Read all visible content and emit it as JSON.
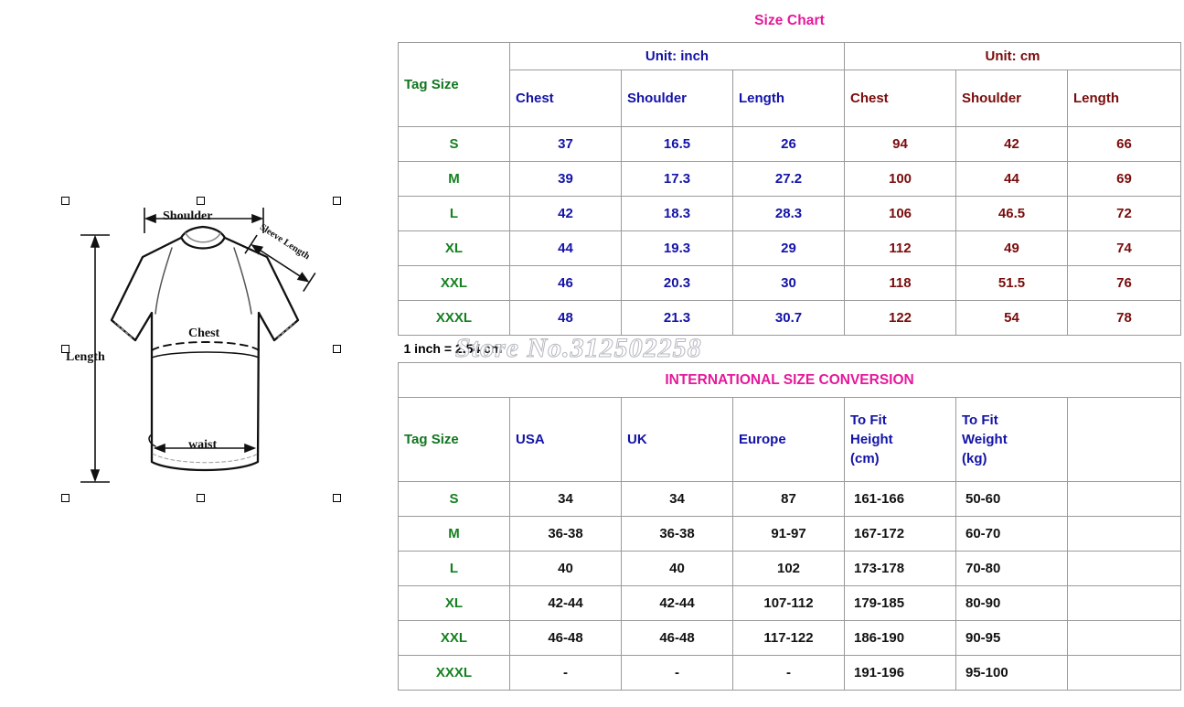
{
  "diagram": {
    "labels": {
      "shoulder": "Shoulder",
      "sleeve_length": "Sleeve Length",
      "chest": "Chest",
      "length": "Length",
      "waist": "waist"
    }
  },
  "watermark": "Store No.312502258",
  "size_chart": {
    "title": "Size Chart",
    "unit_groups": {
      "inch": "Unit: inch",
      "cm": "Unit: cm"
    },
    "tag_size_header": "Tag Size",
    "columns_inch": [
      "Chest",
      "Shoulder",
      "Length"
    ],
    "columns_cm": [
      "Chest",
      "Shoulder",
      "Length"
    ],
    "note": "1 inch = 2.54 cm",
    "rows": [
      {
        "size": "S",
        "inch": [
          "37",
          "16.5",
          "26"
        ],
        "cm": [
          "94",
          "42",
          "66"
        ]
      },
      {
        "size": "M",
        "inch": [
          "39",
          "17.3",
          "27.2"
        ],
        "cm": [
          "100",
          "44",
          "69"
        ]
      },
      {
        "size": "L",
        "inch": [
          "42",
          "18.3",
          "28.3"
        ],
        "cm": [
          "106",
          "46.5",
          "72"
        ]
      },
      {
        "size": "XL",
        "inch": [
          "44",
          "19.3",
          "29"
        ],
        "cm": [
          "112",
          "49",
          "74"
        ]
      },
      {
        "size": "XXL",
        "inch": [
          "46",
          "20.3",
          "30"
        ],
        "cm": [
          "118",
          "51.5",
          "76"
        ]
      },
      {
        "size": "XXXL",
        "inch": [
          "48",
          "21.3",
          "30.7"
        ],
        "cm": [
          "122",
          "54",
          "78"
        ]
      }
    ]
  },
  "international": {
    "title": "INTERNATIONAL SIZE CONVERSION",
    "tag_size_header": "Tag Size",
    "columns": [
      "USA",
      "UK",
      "Europe",
      "To Fit Height (cm)",
      "To Fit Weight (kg)"
    ],
    "column_lines": {
      "usa": "USA",
      "uk": "UK",
      "europe": "Europe",
      "height_l1": "To Fit",
      "height_l2": "Height",
      "height_l3": "(cm)",
      "weight_l1": "To Fit",
      "weight_l2": "Weight",
      "weight_l3": "(kg)"
    },
    "rows": [
      {
        "size": "S",
        "usa": "34",
        "uk": "34",
        "europe": "87",
        "height": "161-166",
        "weight": "50-60"
      },
      {
        "size": "M",
        "usa": "36-38",
        "uk": "36-38",
        "europe": "91-97",
        "height": "167-172",
        "weight": "60-70"
      },
      {
        "size": "L",
        "usa": "40",
        "uk": "40",
        "europe": "102",
        "height": "173-178",
        "weight": "70-80"
      },
      {
        "size": "XL",
        "usa": "42-44",
        "uk": "42-44",
        "europe": "107-112",
        "height": "179-185",
        "weight": "80-90"
      },
      {
        "size": "XXL",
        "usa": "46-48",
        "uk": "46-48",
        "europe": "117-122",
        "height": "186-190",
        "weight": "90-95"
      },
      {
        "size": "XXXL",
        "usa": "-",
        "uk": "-",
        "europe": "-",
        "height": "191-196",
        "weight": "95-100"
      }
    ]
  },
  "colors": {
    "title_pink": "#e5189a",
    "green": "#14801f",
    "blue": "#1313a8",
    "maroon": "#7a0c0c",
    "black": "#121212",
    "grid_line": "#9a9a9a"
  }
}
